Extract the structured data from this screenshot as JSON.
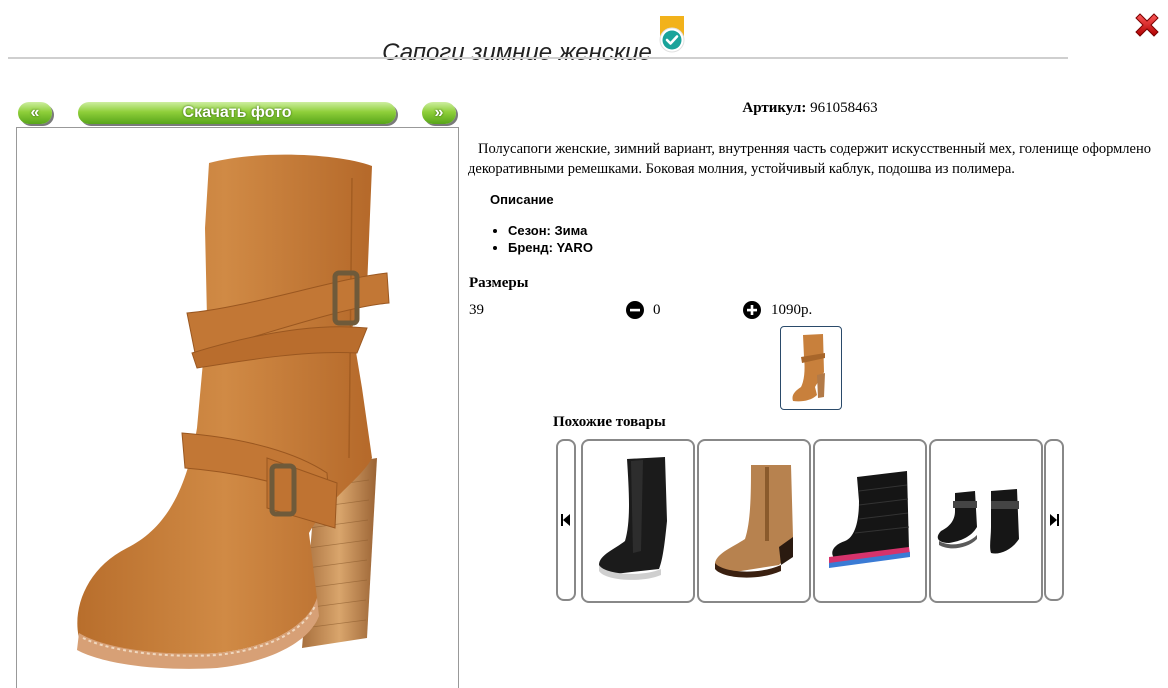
{
  "header": {
    "title": "Сапоги зимние женские",
    "close_icon": "close-icon"
  },
  "photo": {
    "prev_label": "«",
    "download_label": "Скачать фото",
    "next_label": "»"
  },
  "product": {
    "sku_label": "Артикул:",
    "sku_value": "961058463",
    "description": "Полусапоги женские, зимний вариант, внутренняя часть содержит искусственный мех, голенище оформлено декоративными ремешками. Боковая молния, устойчивый каблук, подошва из полимера.",
    "spec_title": "Описание",
    "specs": [
      "Сезон: Зима",
      "Бренд: YARO"
    ]
  },
  "sizes": {
    "title": "Размеры",
    "rows": [
      {
        "size": "39",
        "quantity": "0",
        "price": "1090р."
      }
    ]
  },
  "similar": {
    "title": "Похожие товары",
    "items": [
      {
        "icon": "black-leather-boot"
      },
      {
        "icon": "tan-leather-boot"
      },
      {
        "icon": "black-padded-boot"
      },
      {
        "icon": "black-kids-boots"
      }
    ]
  },
  "colors": {
    "accent_green": "#8fcf3a",
    "close_red": "#cc1111",
    "badge_teal": "#1aa39a",
    "badge_gold": "#f2b21b",
    "boot_tan": "#c9803c"
  }
}
